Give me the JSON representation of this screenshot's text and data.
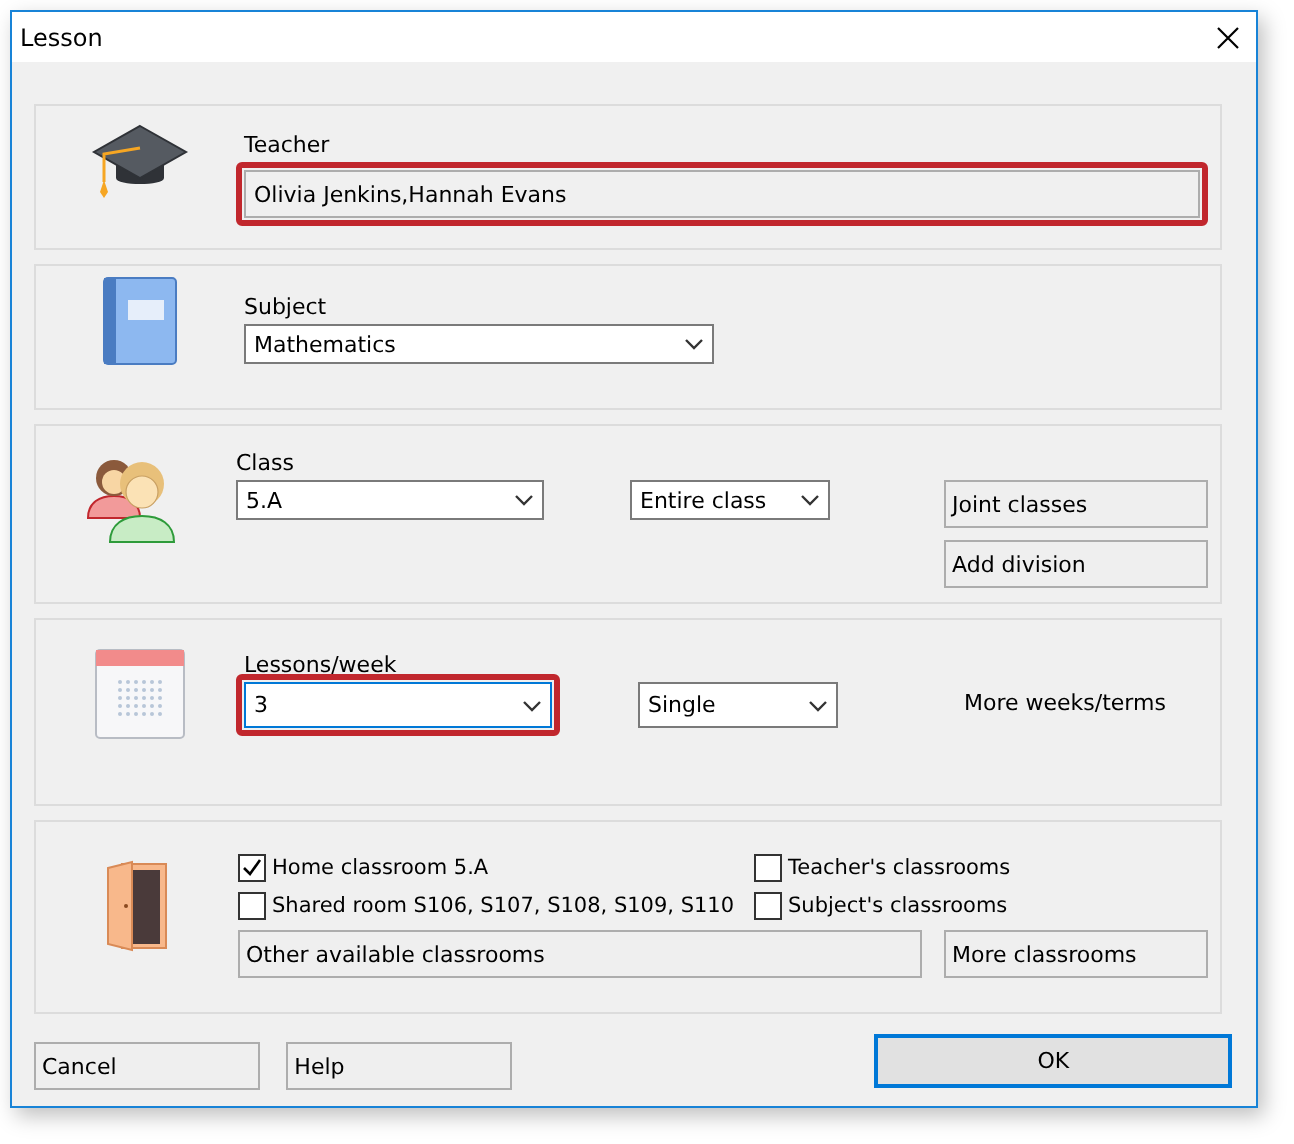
{
  "window": {
    "title": "Lesson"
  },
  "teacher": {
    "label": "Teacher",
    "value": "Olivia Jenkins,Hannah Evans",
    "highlighted": true
  },
  "subject": {
    "label": "Subject",
    "value": "Mathematics"
  },
  "class": {
    "label": "Class",
    "value": "5.A",
    "part": "Entire class",
    "buttons": [
      "Joint classes",
      "Add division"
    ]
  },
  "lessons": {
    "label": "Lessons/week",
    "value": "3",
    "highlighted": true,
    "type": "Single",
    "link": "More weeks/terms"
  },
  "rooms": {
    "checkboxes": [
      {
        "label": "Home classroom 5.A",
        "checked": true
      },
      {
        "label": "Teacher's classrooms",
        "checked": false
      },
      {
        "label": "Shared room S106, S107, S108, S109, S110",
        "checked": false
      },
      {
        "label": "Subject's classrooms",
        "checked": false
      }
    ],
    "field": "Other available classrooms",
    "button": "More classrooms"
  },
  "footer": {
    "buttons": [
      "Cancel",
      "Help"
    ],
    "ok": "OK"
  }
}
